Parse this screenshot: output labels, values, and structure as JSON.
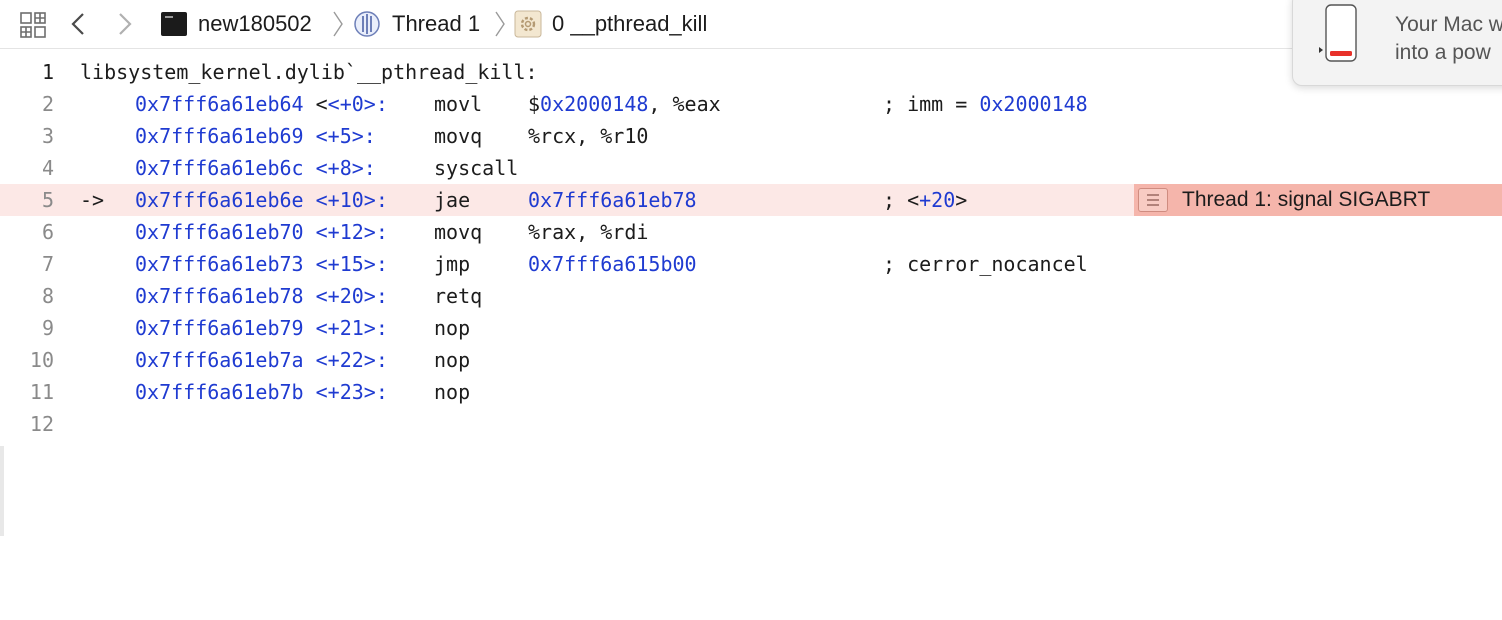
{
  "jumpbar": {
    "project": "new180502",
    "thread": "Thread 1",
    "frame": "0 __pthread_kill"
  },
  "notification": {
    "text": "Your Mac w\ninto a pow"
  },
  "editor": {
    "function_label": "libsystem_kernel.dylib`__pthread_kill:",
    "current_line_marker": "->",
    "annotation": "Thread 1: signal SIGABRT",
    "lines": [
      {
        "num": "1"
      },
      {
        "num": "2",
        "addr": "0x7fff6a61eb64",
        "off": "<+0>:",
        "instr": "movl",
        "op_pre": "$",
        "op_hex": "0x2000148",
        "op_post": ", %eax",
        "cmt_pre": "; imm = ",
        "cmt_hex": "0x2000148"
      },
      {
        "num": "3",
        "addr": "0x7fff6a61eb69",
        "off": "<+5>:",
        "instr": "movq",
        "op": "%rcx, %r10"
      },
      {
        "num": "4",
        "addr": "0x7fff6a61eb6c",
        "off": "<+8>:",
        "instr": "syscall"
      },
      {
        "num": "5",
        "addr": "0x7fff6a61eb6e",
        "off": "<+10>:",
        "instr": "jae",
        "op_hex": "0x7fff6a61eb78",
        "cmt_pre": "; <",
        "cmt_hex": "+20",
        "cmt_post": ">"
      },
      {
        "num": "6",
        "addr": "0x7fff6a61eb70",
        "off": "<+12>:",
        "instr": "movq",
        "op": "%rax, %rdi"
      },
      {
        "num": "7",
        "addr": "0x7fff6a61eb73",
        "off": "<+15>:",
        "instr": "jmp",
        "op_hex": "0x7fff6a615b00",
        "cmt_pre": "; cerror_nocancel"
      },
      {
        "num": "8",
        "addr": "0x7fff6a61eb78",
        "off": "<+20>:",
        "instr": "retq"
      },
      {
        "num": "9",
        "addr": "0x7fff6a61eb79",
        "off": "<+21>:",
        "instr": "nop"
      },
      {
        "num": "10",
        "addr": "0x7fff6a61eb7a",
        "off": "<+22>:",
        "instr": "nop"
      },
      {
        "num": "11",
        "addr": "0x7fff6a61eb7b",
        "off": "<+23>:",
        "instr": "nop"
      },
      {
        "num": "12"
      }
    ]
  },
  "colors": {
    "accent_blue": "#1f3bd1",
    "current_line_bg": "#fce8e6",
    "annotation_bg": "#f5b5ab",
    "battery_low": "#e8312a"
  },
  "icons": [
    "grid-icon",
    "chevron-left-icon",
    "chevron-right-icon",
    "terminal-icon",
    "thread-icon",
    "gear-icon",
    "battery-icon",
    "annotation-menu-icon"
  ]
}
